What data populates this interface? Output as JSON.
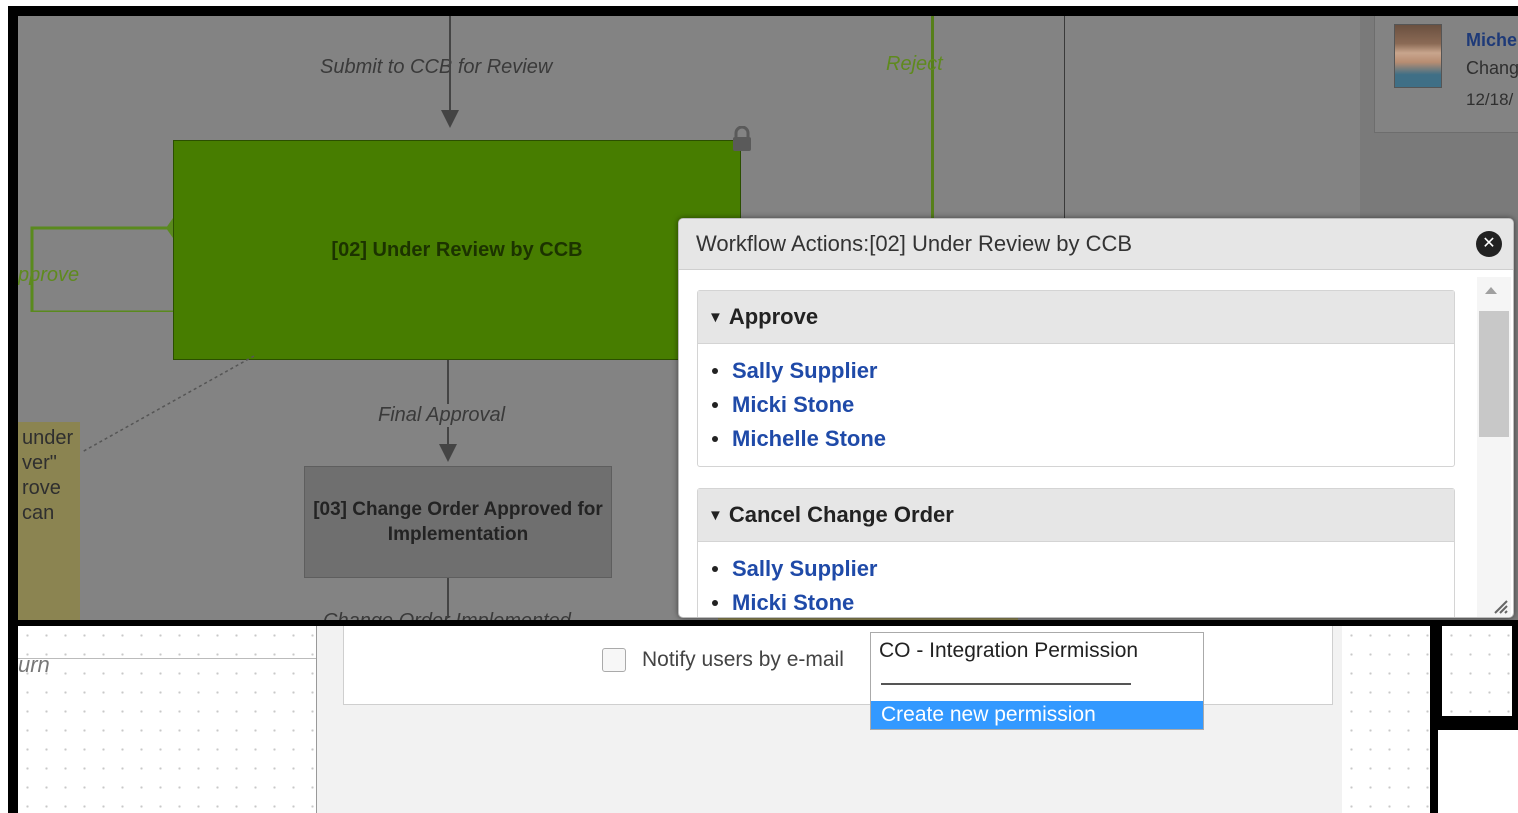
{
  "activity": {
    "name": "Miche",
    "action": "Chang",
    "date": "12/18/"
  },
  "diagram": {
    "transition_top": "Submit to CCB for Review",
    "transition_reject": "Reject",
    "transition_approve": "pprove",
    "node_review": "[02] Under Review by CCB",
    "transition_final": "Final Approval",
    "node_approved": "[03] Change Order Approved for Implementation",
    "transition_implemented": "Change Order Implemented",
    "sticky_note_lines": [
      "under",
      "ver\"",
      "rove",
      "can"
    ]
  },
  "dialog": {
    "title": "Workflow Actions:[02] Under Review by CCB",
    "close_glyph": "✕",
    "groups": [
      {
        "label": "Approve",
        "users": [
          "Sally Supplier",
          "Micki Stone",
          "Michelle Stone"
        ]
      },
      {
        "label": "Cancel Change Order",
        "users": [
          "Sally Supplier",
          "Micki Stone"
        ]
      }
    ],
    "caret_glyph": "▼"
  },
  "bottom": {
    "left_label": "urn",
    "notify_label": "Notify users by e-mail",
    "permission_option": "CO - Integration Permission",
    "create_permission": "Create new permission"
  },
  "icons": {
    "lock": "lock-icon",
    "close": "close-icon",
    "caret": "caret-down-icon",
    "resize": "resize-grip-icon"
  },
  "colors": {
    "link": "#1f4aa8",
    "active_node": "#477d00",
    "selection": "#3399ff"
  }
}
